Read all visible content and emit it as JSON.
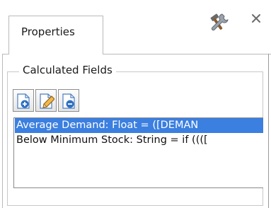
{
  "tab": {
    "label": "Properties"
  },
  "calculated_fields": {
    "title": "Calculated Fields",
    "toolbar": [
      {
        "icon": "add-icon"
      },
      {
        "icon": "edit-icon"
      },
      {
        "icon": "remove-icon"
      }
    ],
    "items": [
      {
        "label": "Average Demand: Float = ([DEMAN",
        "selected": true
      },
      {
        "label": "Below Minimum Stock: String = if ((([",
        "selected": false
      }
    ]
  },
  "colors": {
    "selection": "#3b7fe0",
    "accent_blue": "#2f6fc4",
    "pencil": "#f2b84a"
  }
}
